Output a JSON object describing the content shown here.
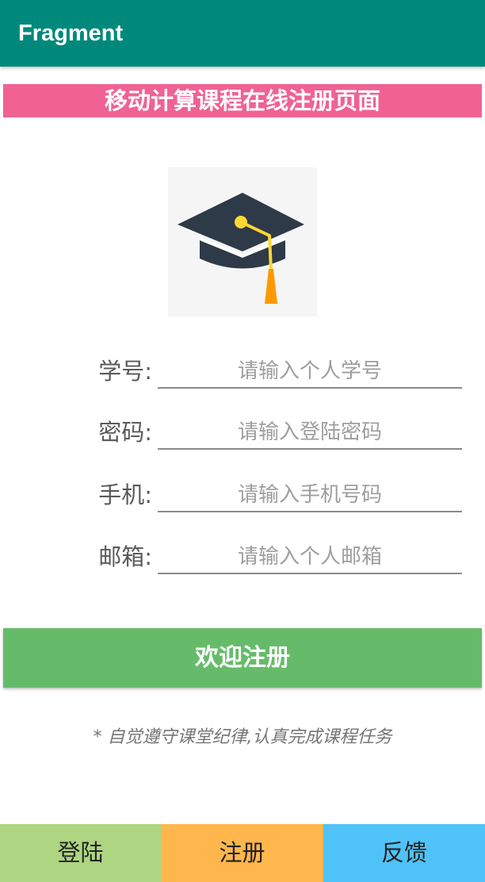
{
  "appbar": {
    "title": "Fragment",
    "color": "#00897b"
  },
  "banner": {
    "text": "移动计算课程在线注册页面",
    "color": "#f06292"
  },
  "logo": {
    "icon": "graduation-cap-icon"
  },
  "form": {
    "rows": [
      {
        "label": "学号:",
        "placeholder": "请输入个人学号",
        "value": ""
      },
      {
        "label": "密码:",
        "placeholder": "请输入登陆密码",
        "value": ""
      },
      {
        "label": "手机:",
        "placeholder": "请输入手机号码",
        "value": ""
      },
      {
        "label": "邮箱:",
        "placeholder": "请输入个人邮箱",
        "value": ""
      }
    ]
  },
  "register_button": {
    "label": "欢迎注册",
    "color": "#66bb6a"
  },
  "notice": "* 自觉遵守课堂纪律,认真完成课程任务",
  "bottom_nav": {
    "items": [
      {
        "label": "登陆",
        "color": "#aed581"
      },
      {
        "label": "注册",
        "color": "#ffb74d"
      },
      {
        "label": "反馈",
        "color": "#4fc3f7"
      }
    ]
  }
}
